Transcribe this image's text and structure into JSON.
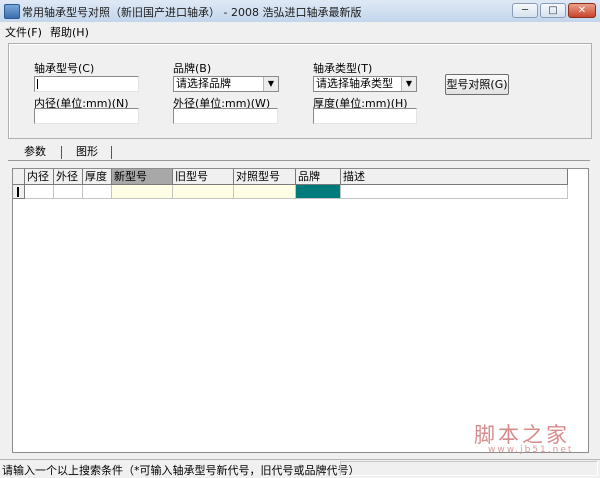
{
  "window": {
    "title": "常用轴承型号对照（新旧国产进口轴承） - 2008 浩弘进口轴承最新版",
    "minimize": "─",
    "maximize": "□",
    "close": "✕"
  },
  "menu": [
    "文件(F)",
    "帮助(H)"
  ],
  "search": {
    "model_label": "轴承型号(C)",
    "model_value": "",
    "brand_label": "品牌(B)",
    "brand_value": "请选择品牌",
    "type_label": "轴承类型(T)",
    "type_value": "请选择轴承类型",
    "inner_label": "内径(单位:mm)(N)",
    "inner_value": "",
    "outer_label": "外径(单位:mm)(W)",
    "outer_value": "",
    "thick_label": "厚度(单位:mm)(H)",
    "thick_value": "",
    "compare_button": "型号对照(G)"
  },
  "tabs": [
    "参数",
    "图形"
  ],
  "table": {
    "columns": [
      "内径",
      "外径",
      "厚度",
      "新型号",
      "旧型号",
      "对照型号",
      "品牌",
      "描述"
    ]
  },
  "status": {
    "text": "请输入一个以上搜索条件（*可输入轴承型号新代号，旧代号或品牌代号）"
  },
  "watermark": {
    "main": "脚本之家",
    "sub": "www.jb51.net"
  },
  "icons": {
    "app": "app-icon",
    "dropdown": "chevron-down-icon"
  },
  "colors": {
    "selected_cell": "#007b7b",
    "editable_cell": "#ffffe6",
    "selected_header": "#a8a8a8"
  }
}
